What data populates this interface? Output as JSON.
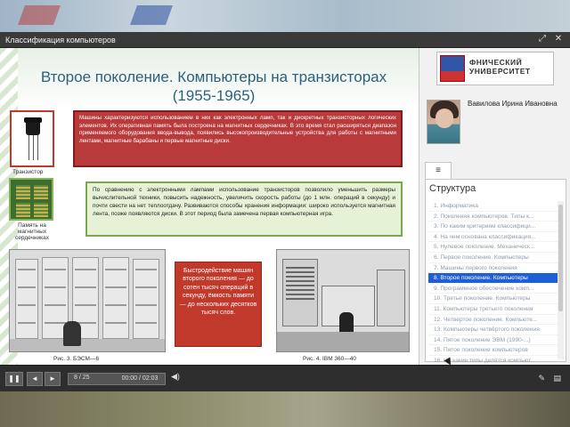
{
  "window": {
    "title": "Классификация компьютеров"
  },
  "slide": {
    "title": "Второе поколение. Компьютеры на транзисторах (1955-1965)",
    "red_text": "Машины характеризуются использованием в них как электронных ламп, так и дискретных транзисторных логических элементов. Их оперативная память была построена на магнитных сердечниках. В это время стал расширяться диапазон применяемого оборудования ввода-вывода, появились высокопроизводительные устройства для работы с магнитными лентами, магнитные барабаны и первые магнитные диски.",
    "green_text": "По сравнению с электронными лампами использование транзисторов позволило уменьшить размеры вычислительной техники, повысить надежность, увеличить скорость работы (до 1 млн. операций в секунду) и почти свести на нет теплоотдачу. Развиваются способы хранения информации: широко используется магнитная лента, позже появляются диски. В этот период была замечена первая компьютерная игра.",
    "mid_text": "Быстродействие машин второго поколения — до сотен тысяч операций в секунду, ёмкость памяти — до нескольких десятков тысяч слов.",
    "caption_transistor": "Транзистор",
    "caption_memory": "Память на магнитных сердечниках",
    "caption_fig3": "Рис. 3.  БЭСМ—6",
    "caption_fig4": "Рис. 4.  IBM 360—40"
  },
  "sidebar": {
    "logo_text": "ФНИЧЕСКИЙ УНИВЕРСИТЕТ",
    "person_name": "Вавилова Ирина Ивановна",
    "list_title": "Структура",
    "items": [
      "1.  Информатика",
      "2.  Поколения компьютеров. Типы к...",
      "3.  По каким критериям классифици...",
      "4.  На чем основана классификация...",
      "5.  Нулевое поколение. Механическ...",
      "6.  Первое поколение. Компьютеры",
      "7.  Машины первого поколения",
      "8.  Второе поколение. Компьютеры",
      "9.  Программное обеспечение комп...",
      "10.  Третье поколение. Компьютеры",
      "11.  Компьютеры третьего поколения",
      "12.  Четвертое поколение. Компьюте...",
      "13.  Компьютеры четвёртого поколения",
      "14.  Пятое поколение ЭВМ (1990-...)",
      "15.  Пятое поколение компьютеров",
      "16.  На какие типы делятся компьют..."
    ],
    "active_index": 7
  },
  "controls": {
    "play": "❚❚",
    "prev": "◄",
    "next": "►",
    "slide_counter": "8 / 25",
    "time": "00:00 / 02:03",
    "volume": "◀)",
    "progress_fraction": 0.0
  }
}
